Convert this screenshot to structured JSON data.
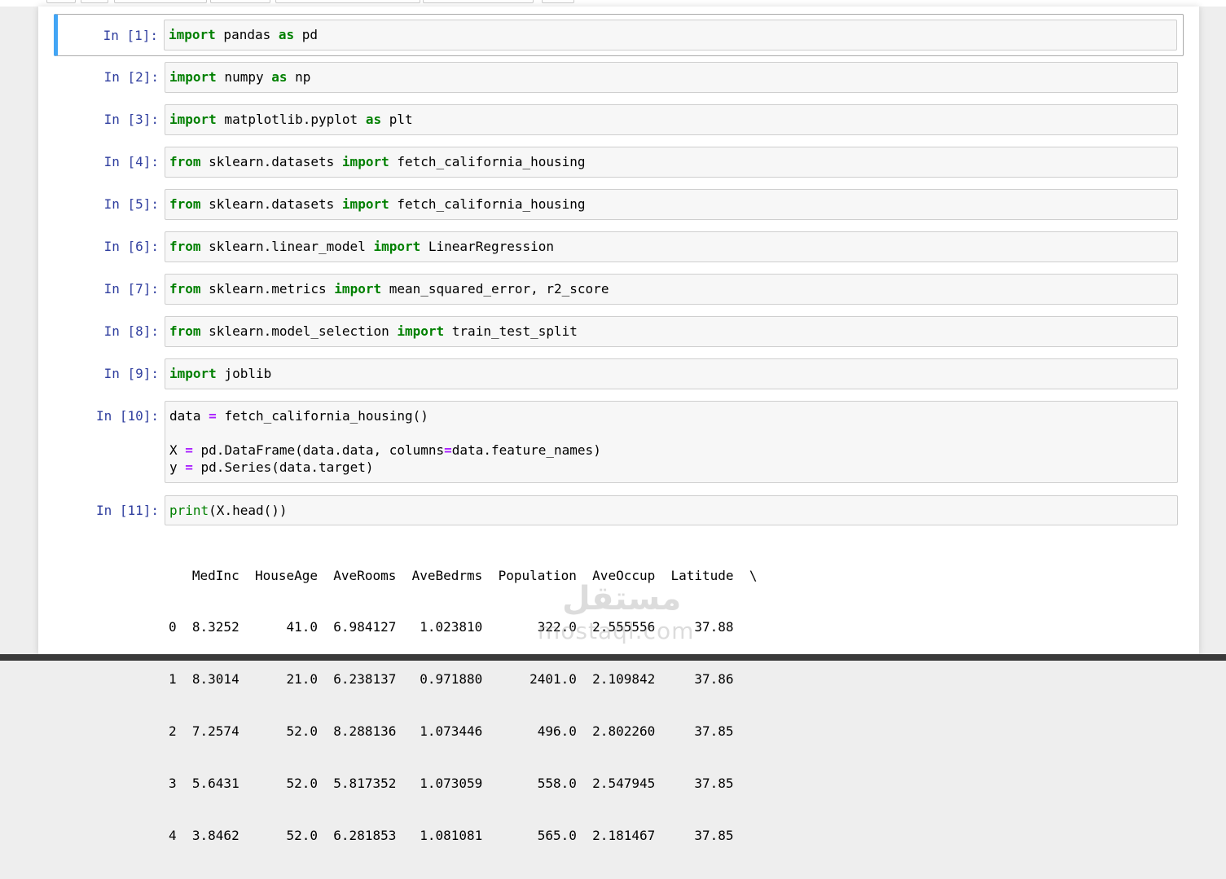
{
  "cells": [
    {
      "prompt": "In [1]:",
      "tokens": [
        [
          "kw",
          "import"
        ],
        [
          "t",
          " pandas "
        ],
        [
          "kw",
          "as"
        ],
        [
          "t",
          " pd"
        ]
      ]
    },
    {
      "prompt": "In [2]:",
      "tokens": [
        [
          "kw",
          "import"
        ],
        [
          "t",
          " numpy "
        ],
        [
          "kw",
          "as"
        ],
        [
          "t",
          " np"
        ]
      ]
    },
    {
      "prompt": "In [3]:",
      "tokens": [
        [
          "kw",
          "import"
        ],
        [
          "t",
          " matplotlib.pyplot "
        ],
        [
          "kw",
          "as"
        ],
        [
          "t",
          " plt"
        ]
      ]
    },
    {
      "prompt": "In [4]:",
      "tokens": [
        [
          "kw",
          "from"
        ],
        [
          "t",
          " sklearn.datasets "
        ],
        [
          "kw",
          "import"
        ],
        [
          "t",
          " fetch_california_housing"
        ]
      ]
    },
    {
      "prompt": "In [5]:",
      "tokens": [
        [
          "kw",
          "from"
        ],
        [
          "t",
          " sklearn.datasets "
        ],
        [
          "kw",
          "import"
        ],
        [
          "t",
          " fetch_california_housing"
        ]
      ]
    },
    {
      "prompt": "In [6]:",
      "tokens": [
        [
          "kw",
          "from"
        ],
        [
          "t",
          " sklearn.linear_model "
        ],
        [
          "kw",
          "import"
        ],
        [
          "t",
          " LinearRegression"
        ]
      ]
    },
    {
      "prompt": "In [7]:",
      "tokens": [
        [
          "kw",
          "from"
        ],
        [
          "t",
          " sklearn.metrics "
        ],
        [
          "kw",
          "import"
        ],
        [
          "t",
          " mean_squared_error, r2_score"
        ]
      ]
    },
    {
      "prompt": "In [8]:",
      "tokens": [
        [
          "kw",
          "from"
        ],
        [
          "t",
          " sklearn.model_selection "
        ],
        [
          "kw",
          "import"
        ],
        [
          "t",
          " train_test_split"
        ]
      ]
    },
    {
      "prompt": "In [9]:",
      "tokens": [
        [
          "kw",
          "import"
        ],
        [
          "t",
          " joblib"
        ]
      ]
    },
    {
      "prompt": "In [10]:",
      "tokens": [
        [
          "t",
          "data "
        ],
        [
          "op",
          "="
        ],
        [
          "t",
          " fetch_california_housing()\n\nX "
        ],
        [
          "op",
          "="
        ],
        [
          "t",
          " pd.DataFrame(data.data, columns"
        ],
        [
          "op",
          "="
        ],
        [
          "t",
          "data.feature_names)\ny "
        ],
        [
          "op",
          "="
        ],
        [
          "t",
          " pd.Series(data.target)"
        ]
      ]
    },
    {
      "prompt": "In [11]:",
      "tokens": [
        [
          "bi",
          "print"
        ],
        [
          "t",
          "(X.head())"
        ]
      ]
    }
  ],
  "output": {
    "header": "   MedInc  HouseAge  AveRooms  AveBedrms  Population  AveOccup  Latitude  \\",
    "rows": [
      "0  8.3252      41.0  6.984127   1.023810       322.0  2.555556     37.88",
      "1  8.3014      21.0  6.238137   0.971880      2401.0  2.109842     37.86",
      "2  7.2574      52.0  8.288136   1.073446       496.0  2.802260     37.85",
      "3  5.6431      52.0  5.817352   1.073059       558.0  2.547945     37.85",
      "4  3.8462      52.0  6.281853   1.081081       565.0  2.181467     37.85"
    ]
  },
  "watermark": {
    "arabic": "مستقل",
    "latin": "mostaql.com"
  },
  "colors": {
    "keyword": "#008000",
    "operator": "#aa22ff",
    "prompt": "#303f9f",
    "selection": "#42a5f5"
  }
}
